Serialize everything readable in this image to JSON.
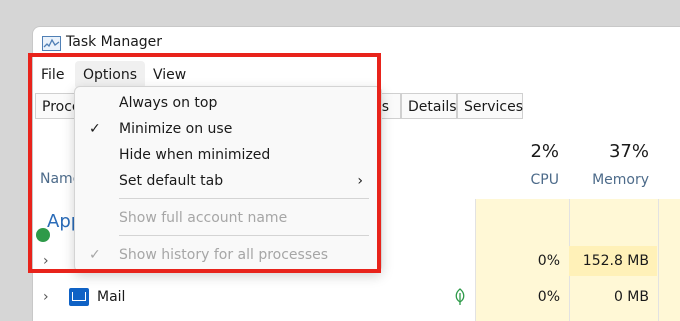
{
  "window": {
    "title": "Task Manager"
  },
  "menu": {
    "file": "File",
    "options": "Options",
    "view": "View"
  },
  "tabs": [
    {
      "label": "Proce"
    },
    {
      "label": "rs"
    },
    {
      "label": "Details"
    },
    {
      "label": "Services"
    }
  ],
  "columns": {
    "name": "Name",
    "cpu": {
      "percent": "2%",
      "label": "CPU"
    },
    "memory": {
      "percent": "37%",
      "label": "Memory"
    }
  },
  "apps_group": "App",
  "rows": [
    {
      "name": "",
      "cpu": "0%",
      "memory": "152.8 MB"
    },
    {
      "name": "Mail",
      "cpu": "0%",
      "memory": "0 MB"
    }
  ],
  "options_menu": {
    "always_on_top": "Always on top",
    "minimize_on_use": "Minimize on use",
    "hide_when_minimized": "Hide when minimized",
    "set_default_tab": "Set default tab",
    "show_full_account_name": "Show full account name",
    "show_history": "Show history for all processes",
    "check_mark": "✓",
    "submenu_arrow": "›"
  },
  "icons": {
    "app": "task-manager-icon",
    "mail": "mail-icon",
    "leaf": "leaf-icon",
    "chevron": "›"
  },
  "colors": {
    "highlight": "#e8231b",
    "heat": "#fff8d6",
    "accent": "#2b6cb8"
  }
}
